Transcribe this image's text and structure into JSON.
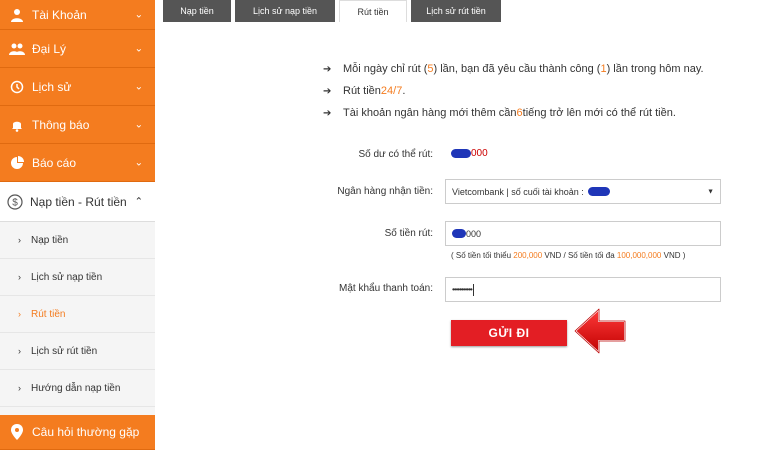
{
  "sidebar": {
    "items": [
      {
        "label": "Tài Khoản",
        "icon": "user-icon"
      },
      {
        "label": "Đại Lý",
        "icon": "group-icon"
      },
      {
        "label": "Lịch sử",
        "icon": "history-icon"
      },
      {
        "label": "Thông báo",
        "icon": "bell-icon"
      },
      {
        "label": "Báo cáo",
        "icon": "pie-chart-icon"
      }
    ],
    "open_section": {
      "label": "Nạp tiền - Rút tiền",
      "icon": "dollar-icon"
    },
    "sub_items": [
      {
        "label": "Nạp tiền"
      },
      {
        "label": "Lịch sử nạp tiền"
      },
      {
        "label": "Rút tiền",
        "active": true
      },
      {
        "label": "Lịch sử rút tiền"
      },
      {
        "label": "Hướng dẫn nạp tiền"
      }
    ],
    "faq": {
      "label": "Câu hỏi thường gặp",
      "icon": "map-pin-icon"
    }
  },
  "tabs": [
    {
      "label": "Nạp tiền"
    },
    {
      "label": "Lịch sử nạp tiền"
    },
    {
      "label": "Rút tiền",
      "active": true
    },
    {
      "label": "Lịch sử rút tiền"
    }
  ],
  "notes": {
    "line1_a": "Mỗi ngày chỉ rút (",
    "line1_limit": "5",
    "line1_b": ") lần, bạn đã yêu cầu thành công (",
    "line1_done": "1",
    "line1_c": ") lần trong hôm nay.",
    "line2_a": "Rút tiền ",
    "line2_hl": "24/7",
    "line2_b": ".",
    "line3_a": "Tài khoản ngân hàng mới thêm cần ",
    "line3_hl": "6",
    "line3_b": " tiếng trở lên mới có thể rút tiền."
  },
  "form": {
    "balance_label": "Số dư có thể rút:",
    "balance_value": "000",
    "bank_label": "Ngân hàng nhận tiền:",
    "bank_value": "Vietcombank | số cuối tài khoản :",
    "amount_label": "Số tiền rút:",
    "amount_value": "000",
    "hint_a": "( Số tiền tối thiểu ",
    "hint_min": "200,000",
    "hint_b": " VND / Số tiền tối đa ",
    "hint_max": "100,000,000",
    "hint_c": " VND )",
    "password_label": "Mật khẩu thanh toán:",
    "password_value": "•••••••••••",
    "submit_label": "GỬI ĐI"
  },
  "colors": {
    "accent": "#f47c1f",
    "submit": "#e31e24",
    "tab_dark": "#555555"
  }
}
